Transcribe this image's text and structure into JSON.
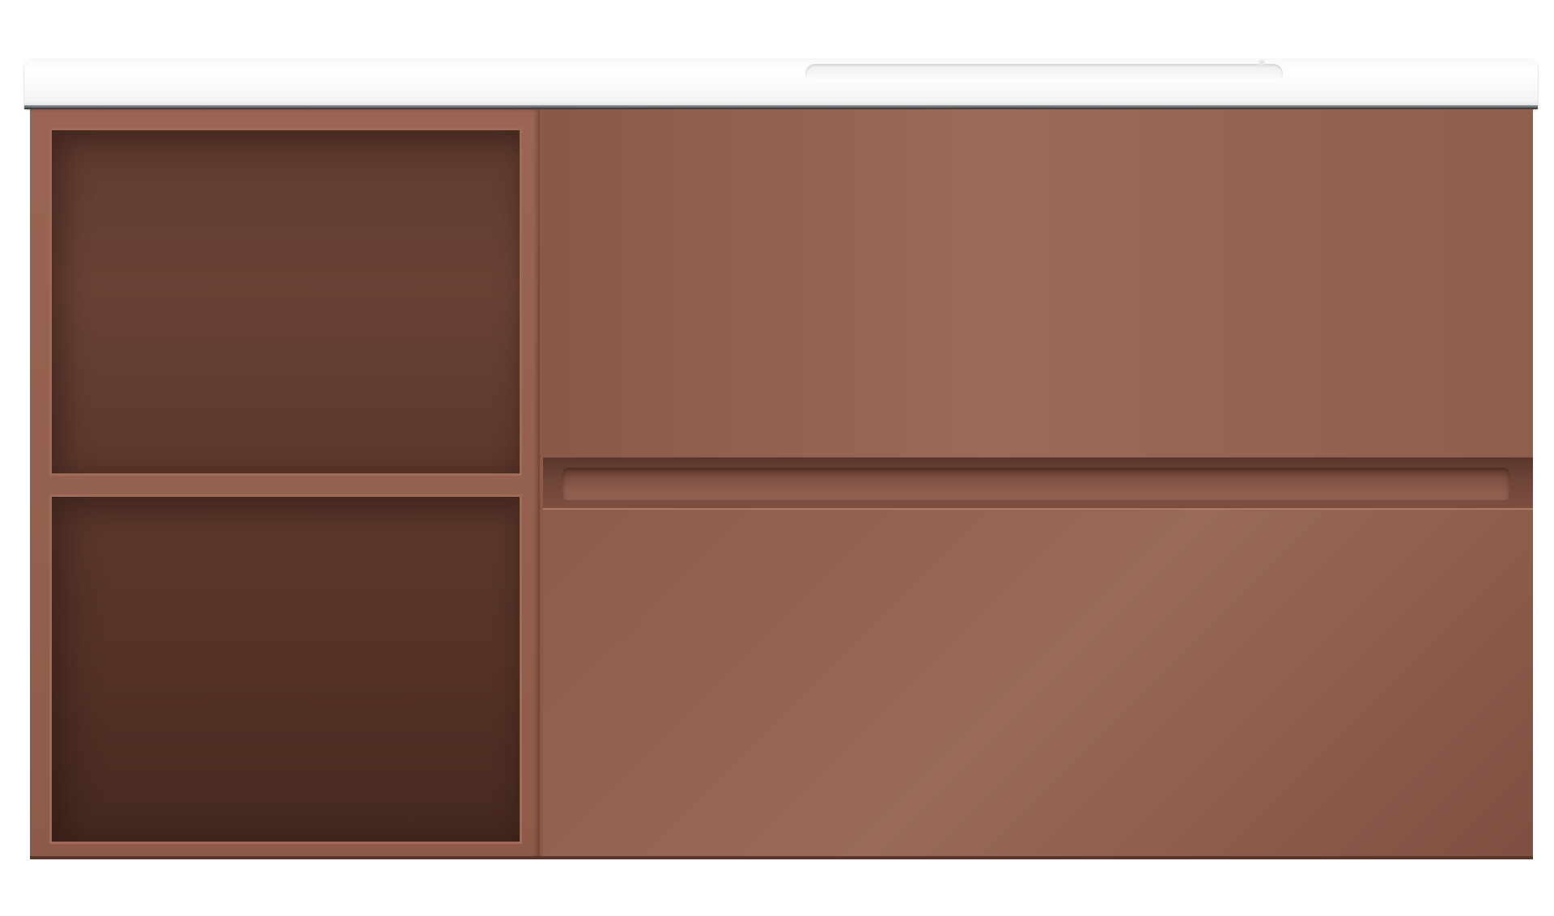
{
  "product": {
    "type": "wall-hung bathroom vanity with integrated basin",
    "finish_color": "#8c5a4a",
    "basin_color": "#ffffff"
  },
  "layout_parts": {
    "countertop": "integrated-basin-top",
    "shelves": [
      "open-shelf-top",
      "open-shelf-bottom"
    ],
    "drawers": [
      "drawer-top",
      "drawer-bottom"
    ],
    "handle": "recessed-channel-handle"
  }
}
